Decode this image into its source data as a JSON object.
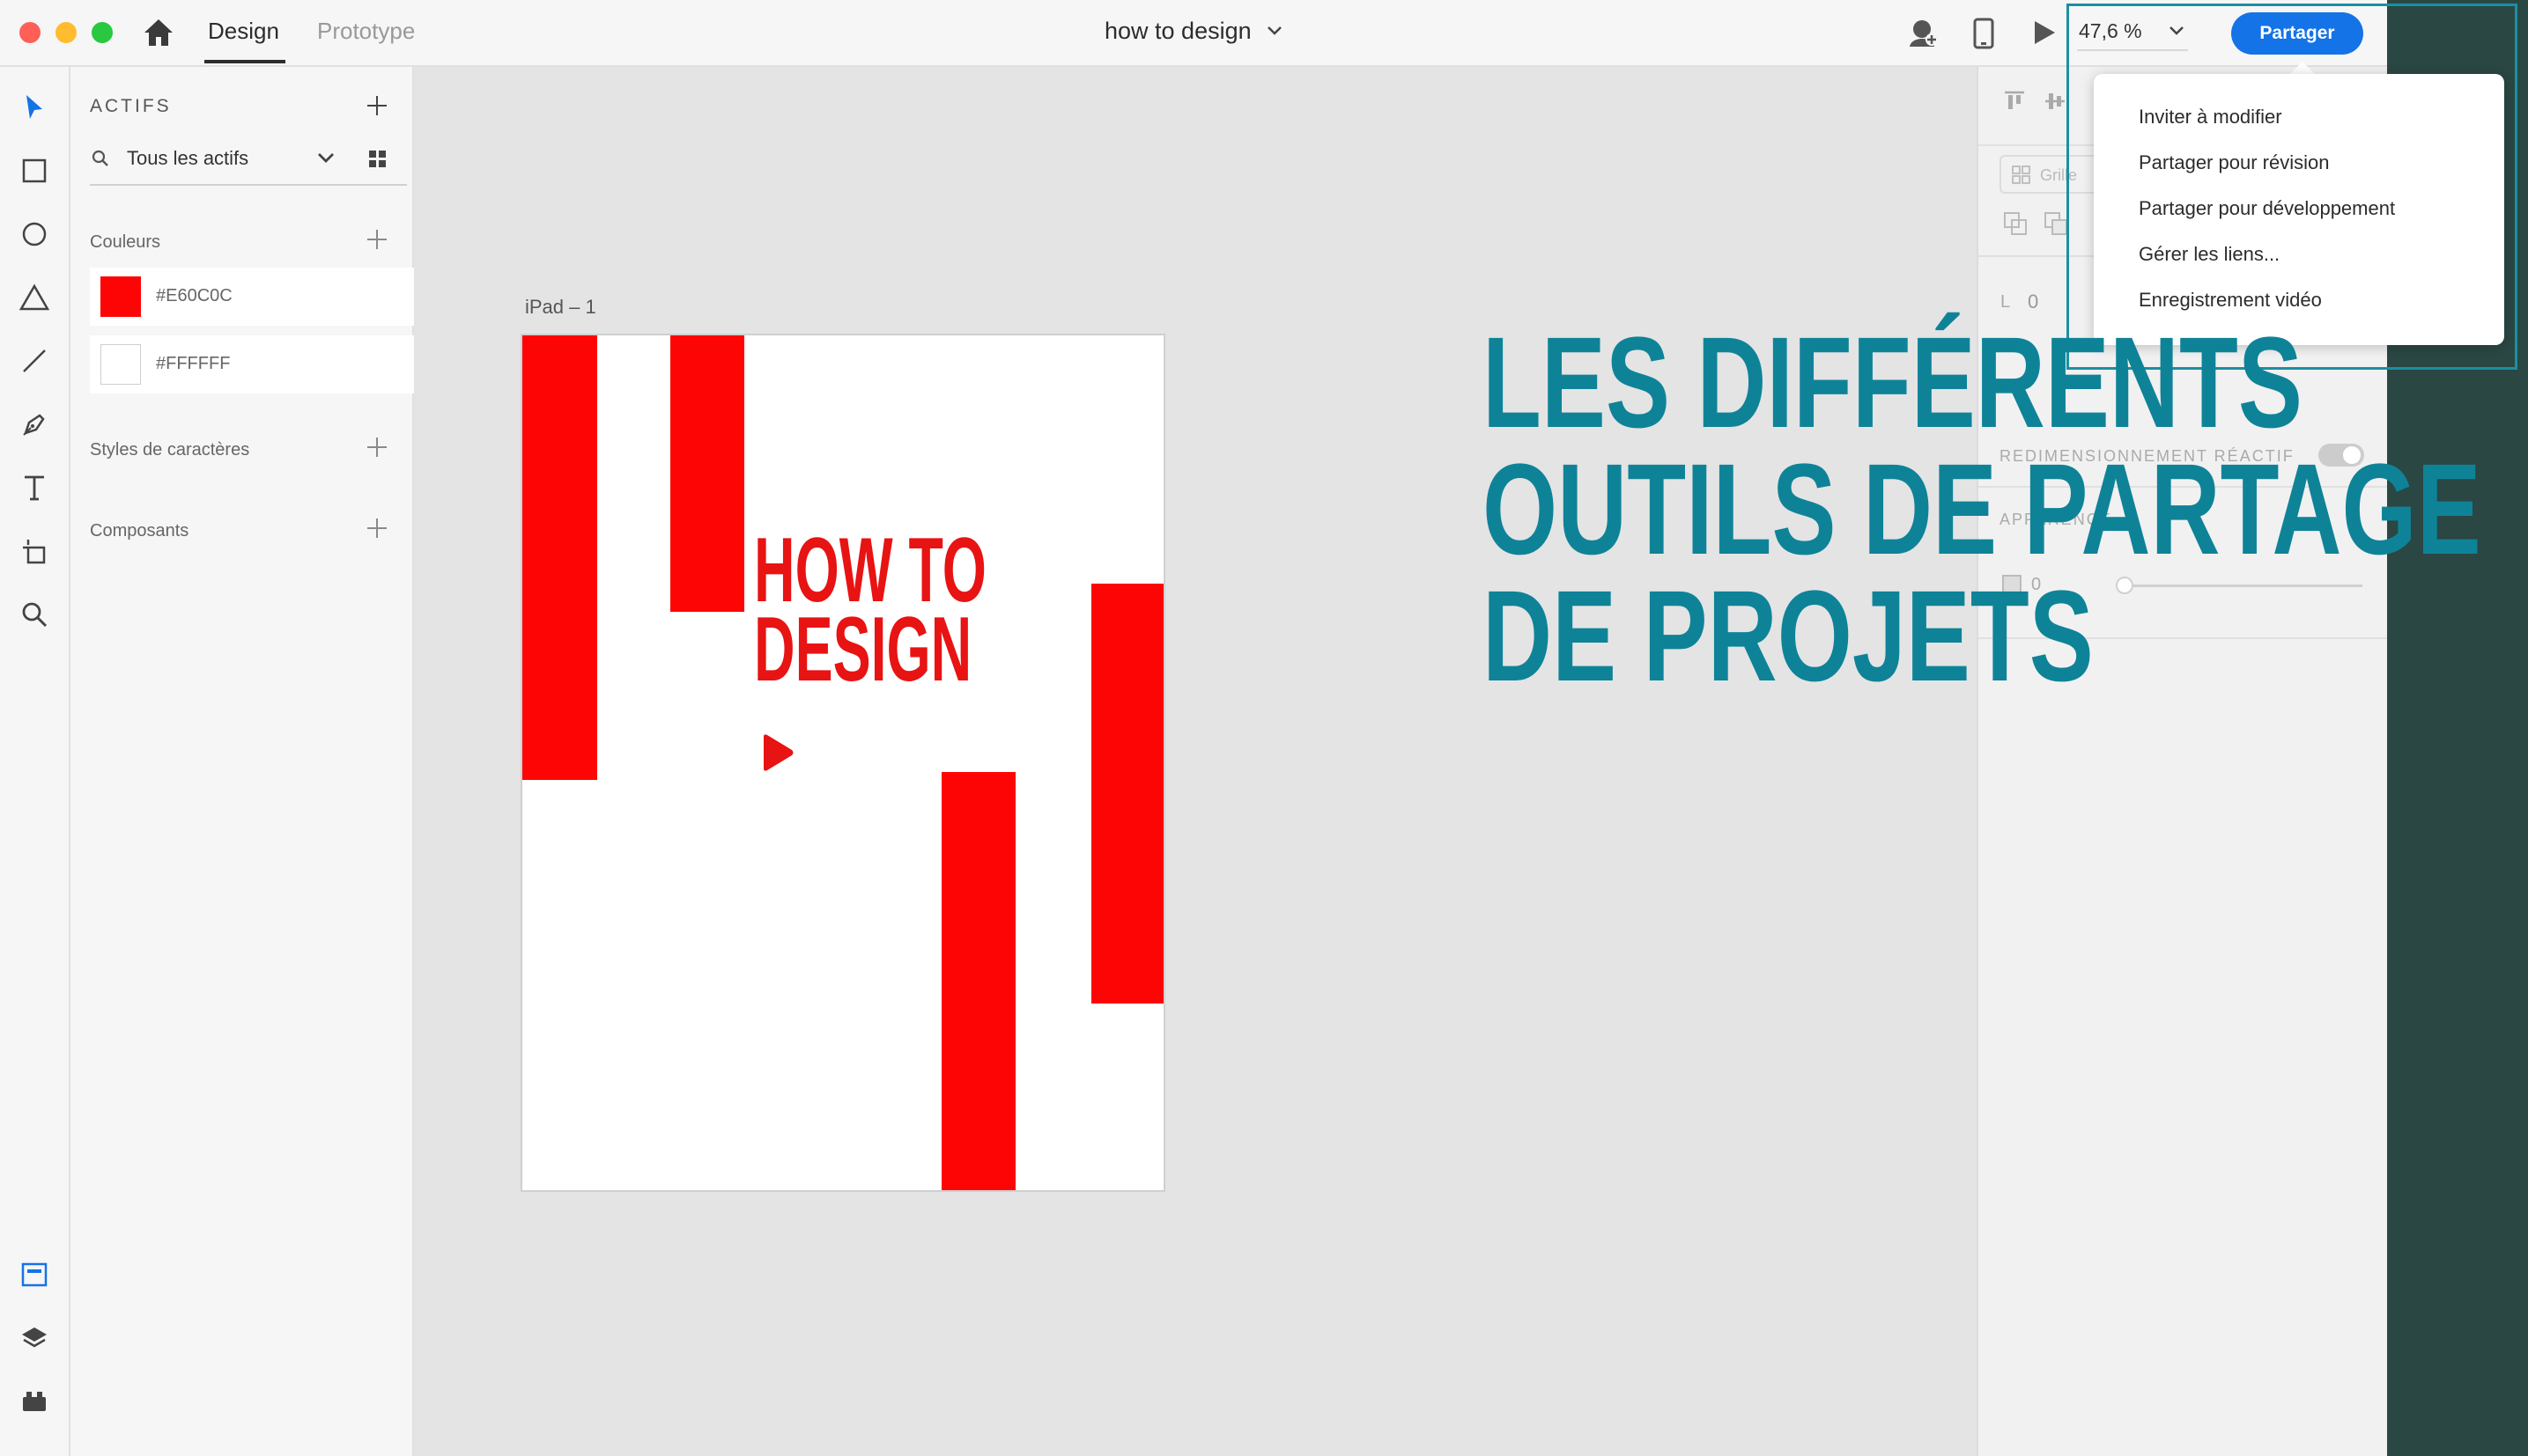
{
  "titlebar": {
    "tab_design": "Design",
    "tab_prototype": "Prototype",
    "document_title": "how to design",
    "zoom": "47,6 %",
    "share_button": "Partager"
  },
  "assets_panel": {
    "title": "ACTIFS",
    "filter": "Tous les actifs",
    "colors_label": "Couleurs",
    "colors": [
      {
        "hex": "#E60C0C",
        "label": "#E60C0C"
      },
      {
        "hex": "#FFFFFF",
        "label": "#FFFFFF"
      }
    ],
    "char_styles_label": "Styles de caractères",
    "components_label": "Composants"
  },
  "canvas": {
    "artboard_label": "iPad – 1",
    "artboard_title_line1": "HOW TO",
    "artboard_title_line2": "DESIGN"
  },
  "right_panel": {
    "grid_label": "Grille",
    "l_label": "L",
    "l_value": "0",
    "responsive_label": "REDIMENSIONNEMENT RÉACTIF",
    "appearance_label": "APPARENCE",
    "opacity_value": "0"
  },
  "share_menu": {
    "items": [
      "Inviter à modifier",
      "Partager pour révision",
      "Partager pour développement",
      "Gérer les liens...",
      "Enregistrement vidéo"
    ]
  },
  "overlay": {
    "line1": "LES DIFFÉRENTS",
    "line2": "OUTILS DE PARTAGE",
    "line3": "DE PROJETS"
  },
  "colors": {
    "accent": "#1473E6",
    "overlay_text": "#0E8398",
    "artboard_red": "#FE0505",
    "side_band": "#2A4744"
  }
}
